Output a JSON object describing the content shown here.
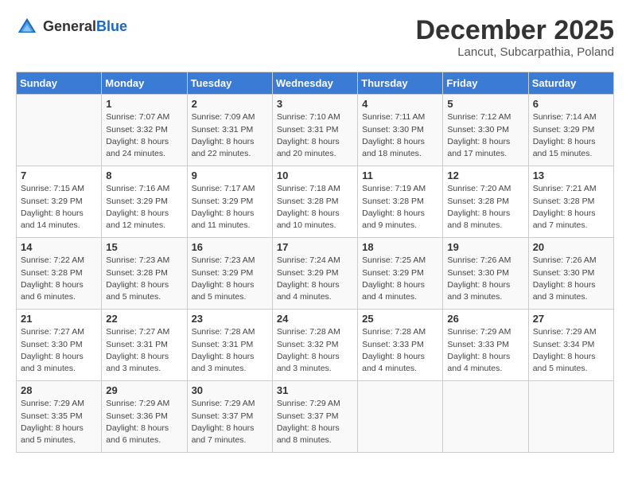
{
  "header": {
    "logo_general": "General",
    "logo_blue": "Blue",
    "main_title": "December 2025",
    "subtitle": "Lancut, Subcarpathia, Poland"
  },
  "days_of_week": [
    "Sunday",
    "Monday",
    "Tuesday",
    "Wednesday",
    "Thursday",
    "Friday",
    "Saturday"
  ],
  "weeks": [
    [
      {
        "day": "",
        "info": ""
      },
      {
        "day": "1",
        "info": "Sunrise: 7:07 AM\nSunset: 3:32 PM\nDaylight: 8 hours\nand 24 minutes."
      },
      {
        "day": "2",
        "info": "Sunrise: 7:09 AM\nSunset: 3:31 PM\nDaylight: 8 hours\nand 22 minutes."
      },
      {
        "day": "3",
        "info": "Sunrise: 7:10 AM\nSunset: 3:31 PM\nDaylight: 8 hours\nand 20 minutes."
      },
      {
        "day": "4",
        "info": "Sunrise: 7:11 AM\nSunset: 3:30 PM\nDaylight: 8 hours\nand 18 minutes."
      },
      {
        "day": "5",
        "info": "Sunrise: 7:12 AM\nSunset: 3:30 PM\nDaylight: 8 hours\nand 17 minutes."
      },
      {
        "day": "6",
        "info": "Sunrise: 7:14 AM\nSunset: 3:29 PM\nDaylight: 8 hours\nand 15 minutes."
      }
    ],
    [
      {
        "day": "7",
        "info": "Sunrise: 7:15 AM\nSunset: 3:29 PM\nDaylight: 8 hours\nand 14 minutes."
      },
      {
        "day": "8",
        "info": "Sunrise: 7:16 AM\nSunset: 3:29 PM\nDaylight: 8 hours\nand 12 minutes."
      },
      {
        "day": "9",
        "info": "Sunrise: 7:17 AM\nSunset: 3:29 PM\nDaylight: 8 hours\nand 11 minutes."
      },
      {
        "day": "10",
        "info": "Sunrise: 7:18 AM\nSunset: 3:28 PM\nDaylight: 8 hours\nand 10 minutes."
      },
      {
        "day": "11",
        "info": "Sunrise: 7:19 AM\nSunset: 3:28 PM\nDaylight: 8 hours\nand 9 minutes."
      },
      {
        "day": "12",
        "info": "Sunrise: 7:20 AM\nSunset: 3:28 PM\nDaylight: 8 hours\nand 8 minutes."
      },
      {
        "day": "13",
        "info": "Sunrise: 7:21 AM\nSunset: 3:28 PM\nDaylight: 8 hours\nand 7 minutes."
      }
    ],
    [
      {
        "day": "14",
        "info": "Sunrise: 7:22 AM\nSunset: 3:28 PM\nDaylight: 8 hours\nand 6 minutes."
      },
      {
        "day": "15",
        "info": "Sunrise: 7:23 AM\nSunset: 3:28 PM\nDaylight: 8 hours\nand 5 minutes."
      },
      {
        "day": "16",
        "info": "Sunrise: 7:23 AM\nSunset: 3:29 PM\nDaylight: 8 hours\nand 5 minutes."
      },
      {
        "day": "17",
        "info": "Sunrise: 7:24 AM\nSunset: 3:29 PM\nDaylight: 8 hours\nand 4 minutes."
      },
      {
        "day": "18",
        "info": "Sunrise: 7:25 AM\nSunset: 3:29 PM\nDaylight: 8 hours\nand 4 minutes."
      },
      {
        "day": "19",
        "info": "Sunrise: 7:26 AM\nSunset: 3:30 PM\nDaylight: 8 hours\nand 3 minutes."
      },
      {
        "day": "20",
        "info": "Sunrise: 7:26 AM\nSunset: 3:30 PM\nDaylight: 8 hours\nand 3 minutes."
      }
    ],
    [
      {
        "day": "21",
        "info": "Sunrise: 7:27 AM\nSunset: 3:30 PM\nDaylight: 8 hours\nand 3 minutes."
      },
      {
        "day": "22",
        "info": "Sunrise: 7:27 AM\nSunset: 3:31 PM\nDaylight: 8 hours\nand 3 minutes."
      },
      {
        "day": "23",
        "info": "Sunrise: 7:28 AM\nSunset: 3:31 PM\nDaylight: 8 hours\nand 3 minutes."
      },
      {
        "day": "24",
        "info": "Sunrise: 7:28 AM\nSunset: 3:32 PM\nDaylight: 8 hours\nand 3 minutes."
      },
      {
        "day": "25",
        "info": "Sunrise: 7:28 AM\nSunset: 3:33 PM\nDaylight: 8 hours\nand 4 minutes."
      },
      {
        "day": "26",
        "info": "Sunrise: 7:29 AM\nSunset: 3:33 PM\nDaylight: 8 hours\nand 4 minutes."
      },
      {
        "day": "27",
        "info": "Sunrise: 7:29 AM\nSunset: 3:34 PM\nDaylight: 8 hours\nand 5 minutes."
      }
    ],
    [
      {
        "day": "28",
        "info": "Sunrise: 7:29 AM\nSunset: 3:35 PM\nDaylight: 8 hours\nand 5 minutes."
      },
      {
        "day": "29",
        "info": "Sunrise: 7:29 AM\nSunset: 3:36 PM\nDaylight: 8 hours\nand 6 minutes."
      },
      {
        "day": "30",
        "info": "Sunrise: 7:29 AM\nSunset: 3:37 PM\nDaylight: 8 hours\nand 7 minutes."
      },
      {
        "day": "31",
        "info": "Sunrise: 7:29 AM\nSunset: 3:37 PM\nDaylight: 8 hours\nand 8 minutes."
      },
      {
        "day": "",
        "info": ""
      },
      {
        "day": "",
        "info": ""
      },
      {
        "day": "",
        "info": ""
      }
    ]
  ]
}
